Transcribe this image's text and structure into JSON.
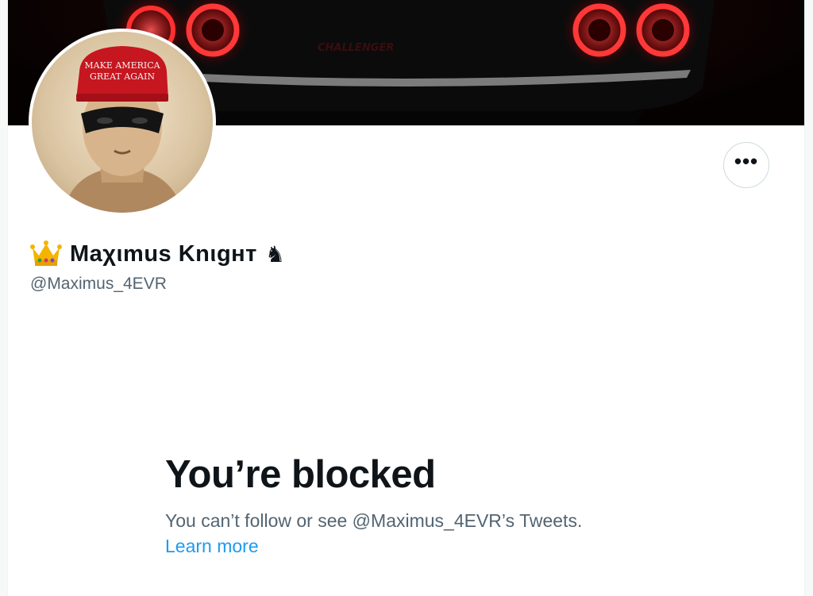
{
  "banner": {
    "car_badge": "CHALLENGER"
  },
  "avatar": {
    "hat_line1": "MAKE AMERICA",
    "hat_line2": "GREAT AGAIN"
  },
  "profile": {
    "display_name": "Maχιmus Knιgнт",
    "knight_glyph": "♞",
    "handle": "@Maximus_4EVR"
  },
  "blocked": {
    "title": "You’re blocked",
    "message": "You can’t follow or see @Maximus_4EVR’s Tweets.",
    "learn_more": "Learn more"
  },
  "colors": {
    "link": "#1d9bf0",
    "secondary_text": "#536471",
    "taillight": "#ff2a2a"
  }
}
